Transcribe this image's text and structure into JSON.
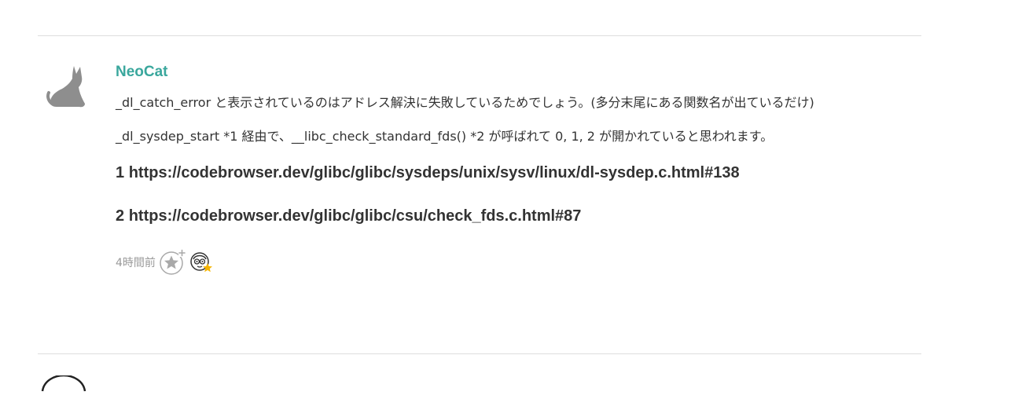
{
  "comment": {
    "username": "NeoCat",
    "paragraph1": "_dl_catch_error と表示されているのはアドレス解決に失敗しているためでしょう。(多分末尾にある関数名が出ているだけ)",
    "paragraph2": "_dl_sysdep_start *1 経由で、__libc_check_standard_fds() *2 が呼ばれて 0, 1, 2 が開かれていると思われます。",
    "footnotes": [
      {
        "number": "1",
        "url": "https://codebrowser.dev/glibc/glibc/sysdeps/unix/sysv/linux/dl-sysdep.c.html#138"
      },
      {
        "number": "2",
        "url": "https://codebrowser.dev/glibc/glibc/csu/check_fds.c.html#87"
      }
    ],
    "timestamp": "4時間前"
  },
  "colors": {
    "username": "#3aa79d",
    "divider": "#dddddd",
    "star": "#f5b400"
  },
  "icons": {
    "avatar": "cat-silhouette-icon",
    "add_star": "add-star-icon",
    "starred_by": "starred-user-avatar-icon",
    "next_avatar": "user-avatar-icon"
  }
}
